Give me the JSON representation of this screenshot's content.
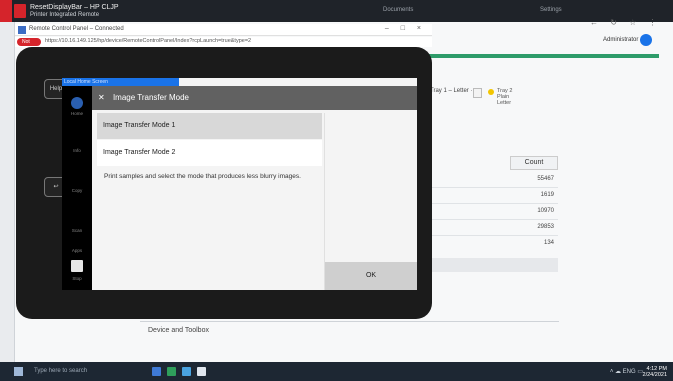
{
  "topbar": {
    "app_title": "ResetDisplayBar – HP CLJP",
    "app_subtitle": "Printer Integrated Remote",
    "menu_left": "Documents",
    "menu_right": "Settings"
  },
  "browser": {
    "window_title": "Remote Control Panel – Connected",
    "window_controls": "– □ ×",
    "address_pill": "Not secure",
    "address_url": "https://10.16.149.125/hp/device/RemoteControlPanel/Index?rcpLaunch=true&type=2",
    "nav_icons": "← ↻ ☆ ⋮",
    "user_name": "Administrator"
  },
  "background_page": {
    "tray_text": "Tray 1 – Letter ·",
    "tray_label": "Tray 2\nPlain\nLetter",
    "column_header": "Count",
    "cells": [
      "55467",
      "1619",
      "10970",
      "29853",
      "134"
    ],
    "bottom_link": "Device and Toolbox"
  },
  "device": {
    "rail_header": "Local Home Screen",
    "side_button_top": "Help",
    "side_button_mid": "Back",
    "rail_home_label": "Home",
    "rail_items": [
      "Info",
      "Copy",
      "Scan",
      "Apps"
    ],
    "rail_bottom_label": "Stop",
    "panel_title": "Image Transfer Mode",
    "close_glyph": "✕",
    "option_1": "Image Transfer Mode 1",
    "option_2": "Image Transfer Mode 2",
    "description": "Print samples and select the mode that produces less blurry images.",
    "ok_label": "OK"
  },
  "taskbar": {
    "search_text": "Type here to search",
    "tray_text": "˄ ☁ ENG ▭",
    "clock_time": "4:12 PM",
    "clock_date": "2/24/2021",
    "app_colors": [
      "#3f7ad6",
      "#2f9e5b",
      "#4aa3e0",
      "#e0e6ee"
    ]
  }
}
